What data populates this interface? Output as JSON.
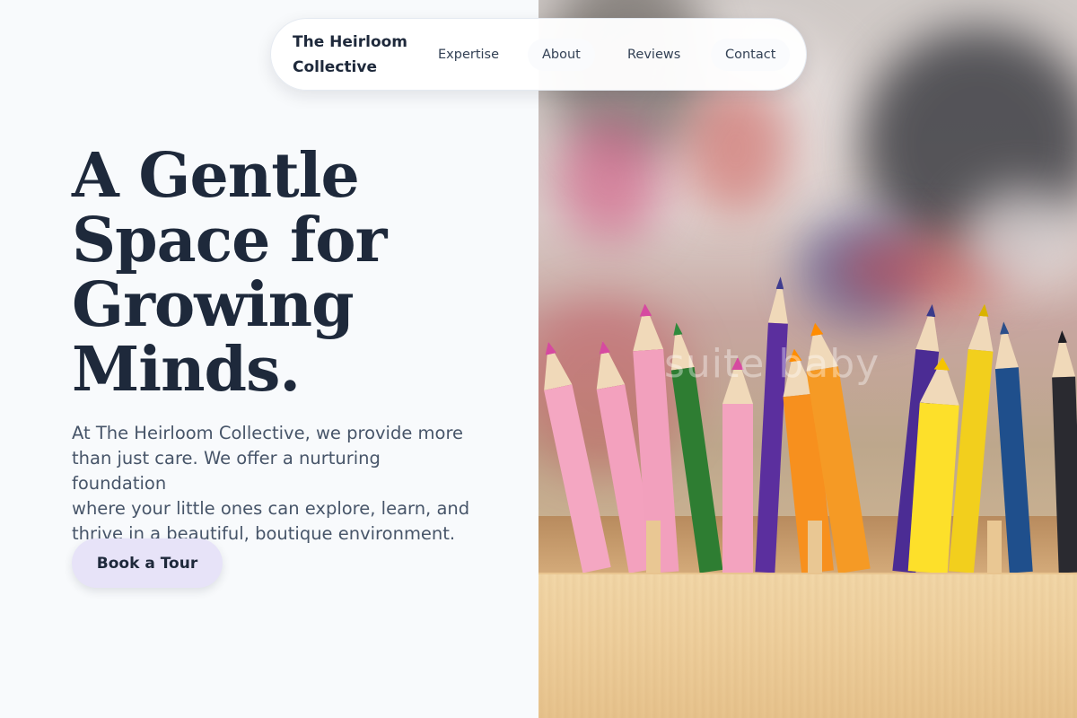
{
  "brand": {
    "name_line1": "The Heirloom",
    "name_line2": "Collective"
  },
  "nav": {
    "items": [
      {
        "label": "Expertise"
      },
      {
        "label": "About"
      },
      {
        "label": "Reviews"
      },
      {
        "label": "Contact"
      }
    ]
  },
  "hero": {
    "headline_lines": [
      "A Gentle",
      "Space for",
      "Growing",
      "Minds."
    ],
    "intro_lines": [
      "At The Heirloom Collective, we provide more",
      "than just care. We offer a nurturing foundation",
      "where your little ones can explore, learn, and",
      "thrive in a beautiful, boutique environment."
    ],
    "cta_label": "Book a Tour"
  },
  "photo": {
    "watermark": "suite baby"
  },
  "colors": {
    "page_bg": "#f8fafc",
    "headline": "#1e293b",
    "body_text": "#475569",
    "cta_bg": "#e7e3f8"
  }
}
